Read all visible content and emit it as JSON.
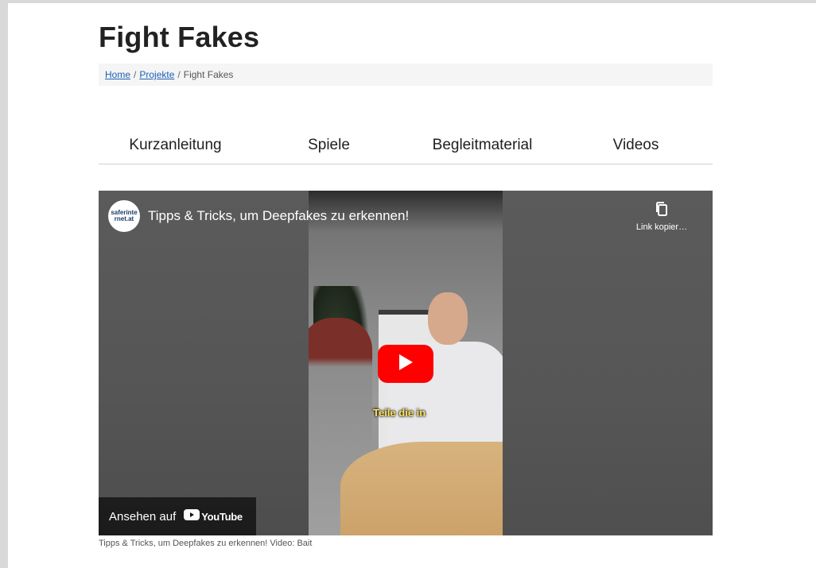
{
  "page": {
    "title": "Fight Fakes"
  },
  "breadcrumb": {
    "home": "Home",
    "projekte": "Projekte",
    "current": "Fight Fakes",
    "separator": "/"
  },
  "tabs": [
    "Kurzanleitung",
    "Spiele",
    "Begleitmaterial",
    "Videos"
  ],
  "video": {
    "channel_logo_text": "saferinternet.at",
    "title": "Tipps & Tricks, um Deepfakes zu erkennen!",
    "copy_link_label": "Link kopier…",
    "subtitle": "Teile die in",
    "watch_on_label": "Ansehen auf",
    "youtube_label": "YouTube"
  },
  "caption": "Tipps & Tricks, um Deepfakes zu erkennen! Video: Bait",
  "colors": {
    "link": "#1a5fb4",
    "youtube_red": "#ff0000",
    "subtitle_yellow": "#ffe35a"
  }
}
